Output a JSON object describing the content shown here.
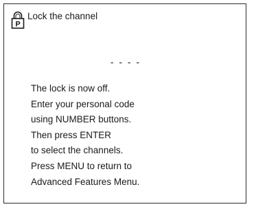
{
  "screen": {
    "title": "Lock the channel",
    "icon": "padlock-p-icon",
    "code_display": "- - - -",
    "instructions": [
      "The lock is now off.",
      "Enter your personal code",
      "using NUMBER buttons.",
      "Then press ENTER",
      "to select the channels.",
      "Press MENU to return to",
      "Advanced Features Menu."
    ]
  },
  "colors": {
    "background": "#ffffff",
    "text": "#1a1a1a",
    "border": "#2a2a2a"
  }
}
